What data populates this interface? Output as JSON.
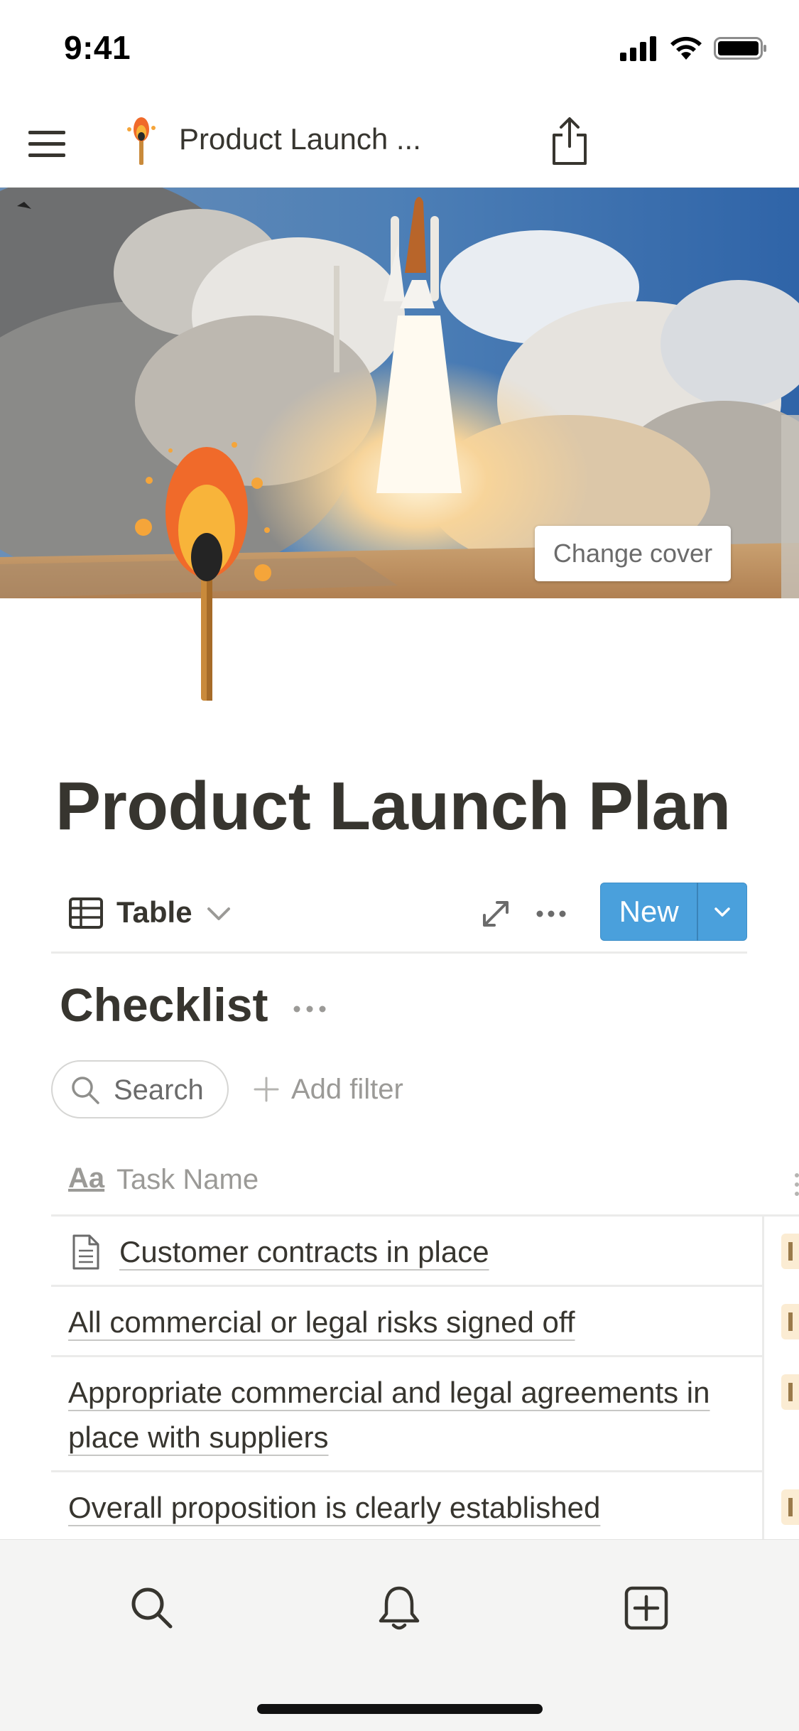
{
  "status_bar": {
    "time": "9:41"
  },
  "nav": {
    "title": "Product Launch ...",
    "icons": [
      "menu-icon",
      "match-icon",
      "share-icon"
    ]
  },
  "cover": {
    "change_cover_label": "Change cover"
  },
  "page": {
    "title": "Product Launch Plan",
    "icon": "match-icon"
  },
  "view_bar": {
    "view_label": "Table",
    "new_label": "New",
    "icons": [
      "table-icon",
      "chevron-down-icon",
      "expand-icon",
      "more-icon"
    ]
  },
  "database": {
    "title": "Checklist",
    "search_label": "Search",
    "add_filter_label": "Add filter",
    "column_header": "Task Name",
    "column_header_icon_text": "Aa",
    "rows": [
      {
        "label": "Customer contracts in place",
        "has_doc_icon": true
      },
      {
        "label": "All commercial or legal risks signed off",
        "has_doc_icon": false
      },
      {
        "label": "Appropriate commercial and legal agreements in place with suppliers",
        "has_doc_icon": false
      },
      {
        "label": "Overall proposition is clearly established",
        "has_doc_icon": false
      }
    ]
  },
  "tab_bar": {
    "icons": [
      "search-icon",
      "bell-icon",
      "new-page-icon"
    ]
  },
  "colors": {
    "accent": "#4aa0dc",
    "text": "#37352f",
    "muted": "#9b9a97",
    "tag_bg": "#fbecd3"
  }
}
